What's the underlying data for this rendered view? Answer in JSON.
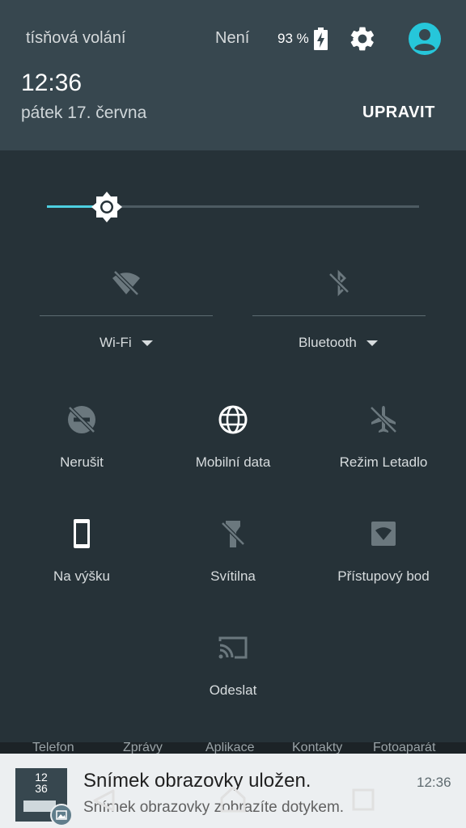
{
  "header": {
    "emergency_text": "tísňová volání",
    "carrier_text": "Není",
    "battery_text": "93 %",
    "time": "12:36",
    "date": "pátek 17. června",
    "edit_label": "UPRAVIT"
  },
  "brightness": {
    "level": 0.16,
    "icon": "brightness-icon"
  },
  "big_tiles": [
    {
      "label": "Wi-Fi",
      "icon": "wifi-off-icon"
    },
    {
      "label": "Bluetooth",
      "icon": "bluetooth-off-icon"
    }
  ],
  "tiles": [
    {
      "label": "Nerušit",
      "icon": "do-not-disturb-off-icon",
      "active": false
    },
    {
      "label": "Mobilní data",
      "icon": "globe-icon",
      "active": true
    },
    {
      "label": "Režim Letadlo",
      "icon": "airplane-off-icon",
      "active": false
    },
    {
      "label": "Na výšku",
      "icon": "portrait-phone-icon",
      "active": true
    },
    {
      "label": "Svítilna",
      "icon": "flashlight-off-icon",
      "active": false
    },
    {
      "label": "Přístupový bod",
      "icon": "hotspot-icon",
      "active": false
    },
    {
      "label": "Odeslat",
      "icon": "cast-icon",
      "active": false
    }
  ],
  "dock": [
    "Telefon",
    "Zprávy",
    "Aplikace",
    "Kontakty",
    "Fotoaparát"
  ],
  "notification": {
    "title": "Snímek obrazovky uložen.",
    "text": "Snímek obrazovky zobrazíte dotykem.",
    "time": "12:36",
    "thumb_time": "12\n36"
  },
  "colors": {
    "accent": "#4dd0e1",
    "panel_bg": "#263238",
    "header_bg": "#37474f"
  }
}
